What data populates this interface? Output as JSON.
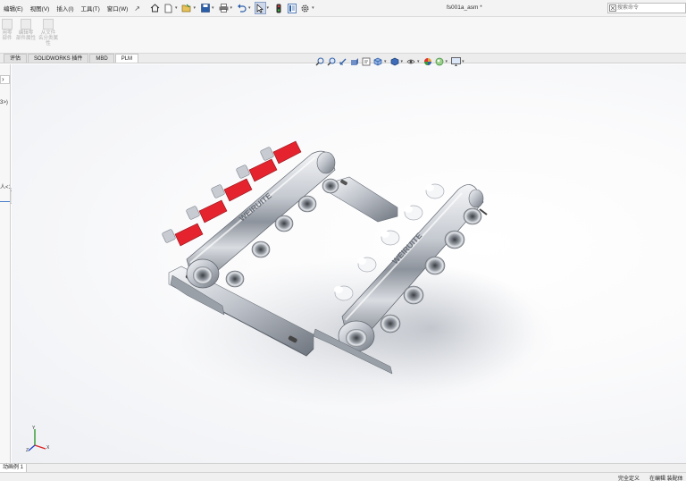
{
  "menu": {
    "items": [
      "编辑(E)",
      "视图(V)",
      "插入(I)",
      "工具(T)",
      "窗口(W)"
    ]
  },
  "document": {
    "title": "fs001a_asm *"
  },
  "search": {
    "placeholder": "搜索命令"
  },
  "ribbon": {
    "buttons": [
      {
        "label_line1": "用零",
        "label_line2": "部件"
      },
      {
        "label_line1": "编辑零",
        "label_line2": "部件属性"
      },
      {
        "label_line1": "从文件",
        "label_line2": "名分类属性"
      }
    ]
  },
  "tabs": [
    "评估",
    "SOLIDWORKS 插件",
    "MBD",
    "PLM"
  ],
  "left_panel": {
    "snippet1": "3>)",
    "snippet2": "人<1"
  },
  "model": {
    "brand_text": "WEIRUITE"
  },
  "bottom_tab": "动画例 1",
  "status": {
    "defined": "完全定义",
    "editing": "在编辑 装配体"
  },
  "triad": {
    "x": "X",
    "y": "Y",
    "z": "Z"
  },
  "colors": {
    "valve_red": "#e4232e",
    "chrome": "#c9cdd3",
    "accent_blue": "#4a7cc9"
  }
}
